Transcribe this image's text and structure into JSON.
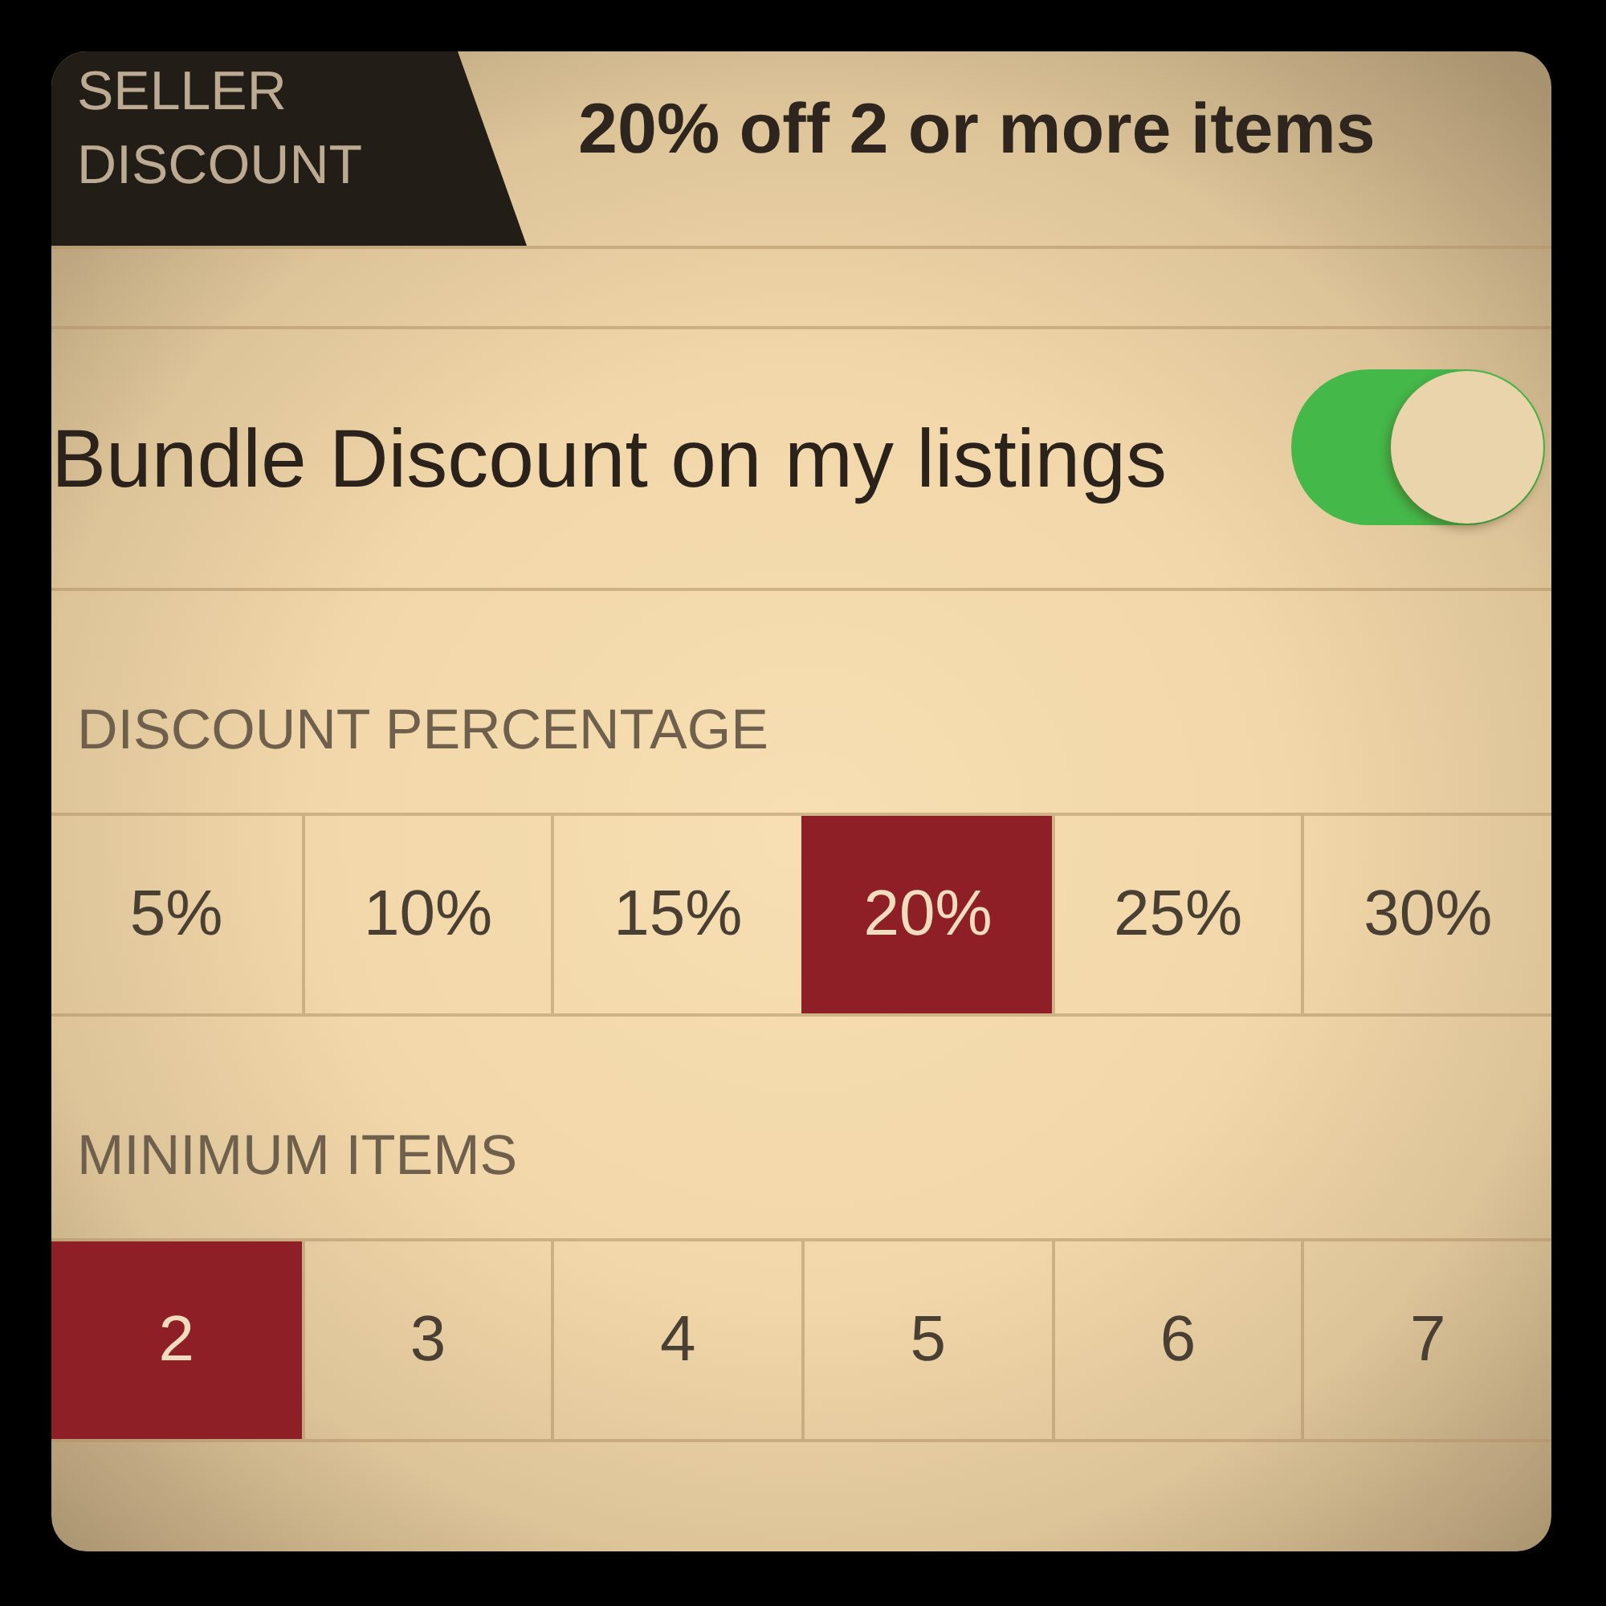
{
  "header": {
    "tag": "SELLER DISCOUNT",
    "title": "20% off 2 or more items"
  },
  "bundle_toggle": {
    "label": "Bundle Discount on my listings",
    "on": true
  },
  "discount_percentage": {
    "heading": "DISCOUNT PERCENTAGE",
    "options": [
      {
        "label": "5%",
        "selected": false
      },
      {
        "label": "10%",
        "selected": false
      },
      {
        "label": "15%",
        "selected": false
      },
      {
        "label": "20%",
        "selected": true
      },
      {
        "label": "25%",
        "selected": false
      },
      {
        "label": "30%",
        "selected": false
      }
    ]
  },
  "minimum_items": {
    "heading": "MINIMUM ITEMS",
    "options": [
      {
        "label": "2",
        "selected": true
      },
      {
        "label": "3",
        "selected": false
      },
      {
        "label": "4",
        "selected": false
      },
      {
        "label": "5",
        "selected": false
      },
      {
        "label": "6",
        "selected": false
      },
      {
        "label": "7",
        "selected": false
      }
    ]
  }
}
